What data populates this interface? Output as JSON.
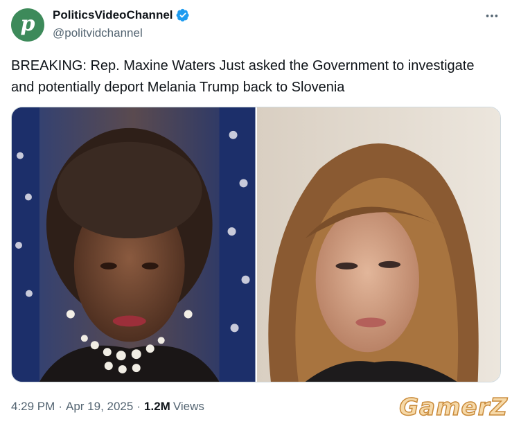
{
  "account": {
    "display_name": "PoliticsVideoChannel",
    "handle": "@politvidchannel",
    "avatar_letter": "p",
    "avatar_color": "#3d8a5a",
    "verified_icon": "verified-badge-icon",
    "verified_color": "#1d9bf0"
  },
  "menu": {
    "icon": "more-horizontal-icon"
  },
  "tweet": {
    "text": "BREAKING: Rep. Maxine Waters Just asked the Government to investigate and potentially deport Melania Trump back to Slovenia"
  },
  "meta": {
    "time": "4:29 PM",
    "separator": "·",
    "date": "Apr 19, 2025",
    "views_count": "1.2M",
    "views_label": "Views"
  },
  "watermark": {
    "text": "GamerZ"
  }
}
